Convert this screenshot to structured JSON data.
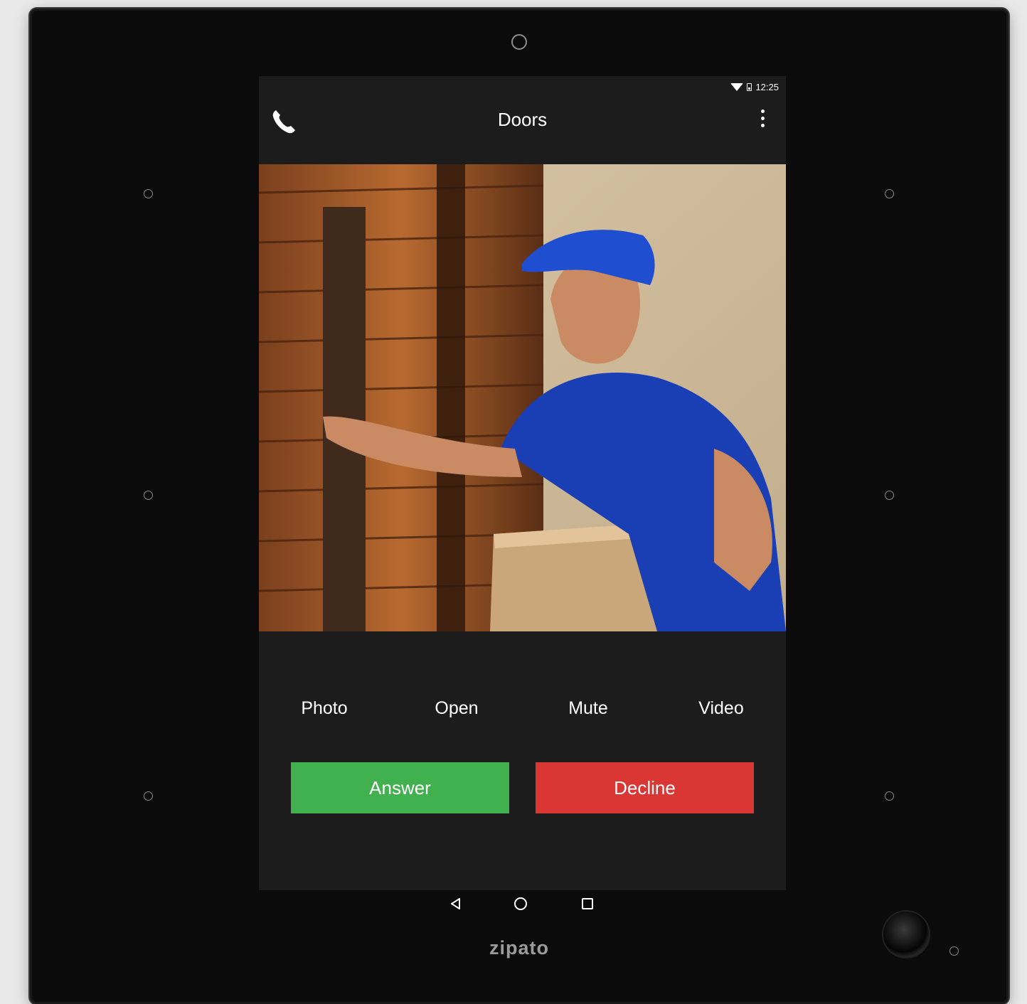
{
  "status": {
    "time": "12:25"
  },
  "app_bar": {
    "title": "Doors",
    "left_icon": "phone-icon",
    "right_icon": "more-vert-icon"
  },
  "video_feed": {
    "description_icon": "camera-feed"
  },
  "actions": [
    {
      "label": "Photo"
    },
    {
      "label": "Open"
    },
    {
      "label": "Mute"
    },
    {
      "label": "Video"
    }
  ],
  "buttons": {
    "answer": "Answer",
    "decline": "Decline"
  },
  "colors": {
    "answer": "#41b04e",
    "decline": "#d93634"
  },
  "brand": {
    "name": "zipato"
  }
}
